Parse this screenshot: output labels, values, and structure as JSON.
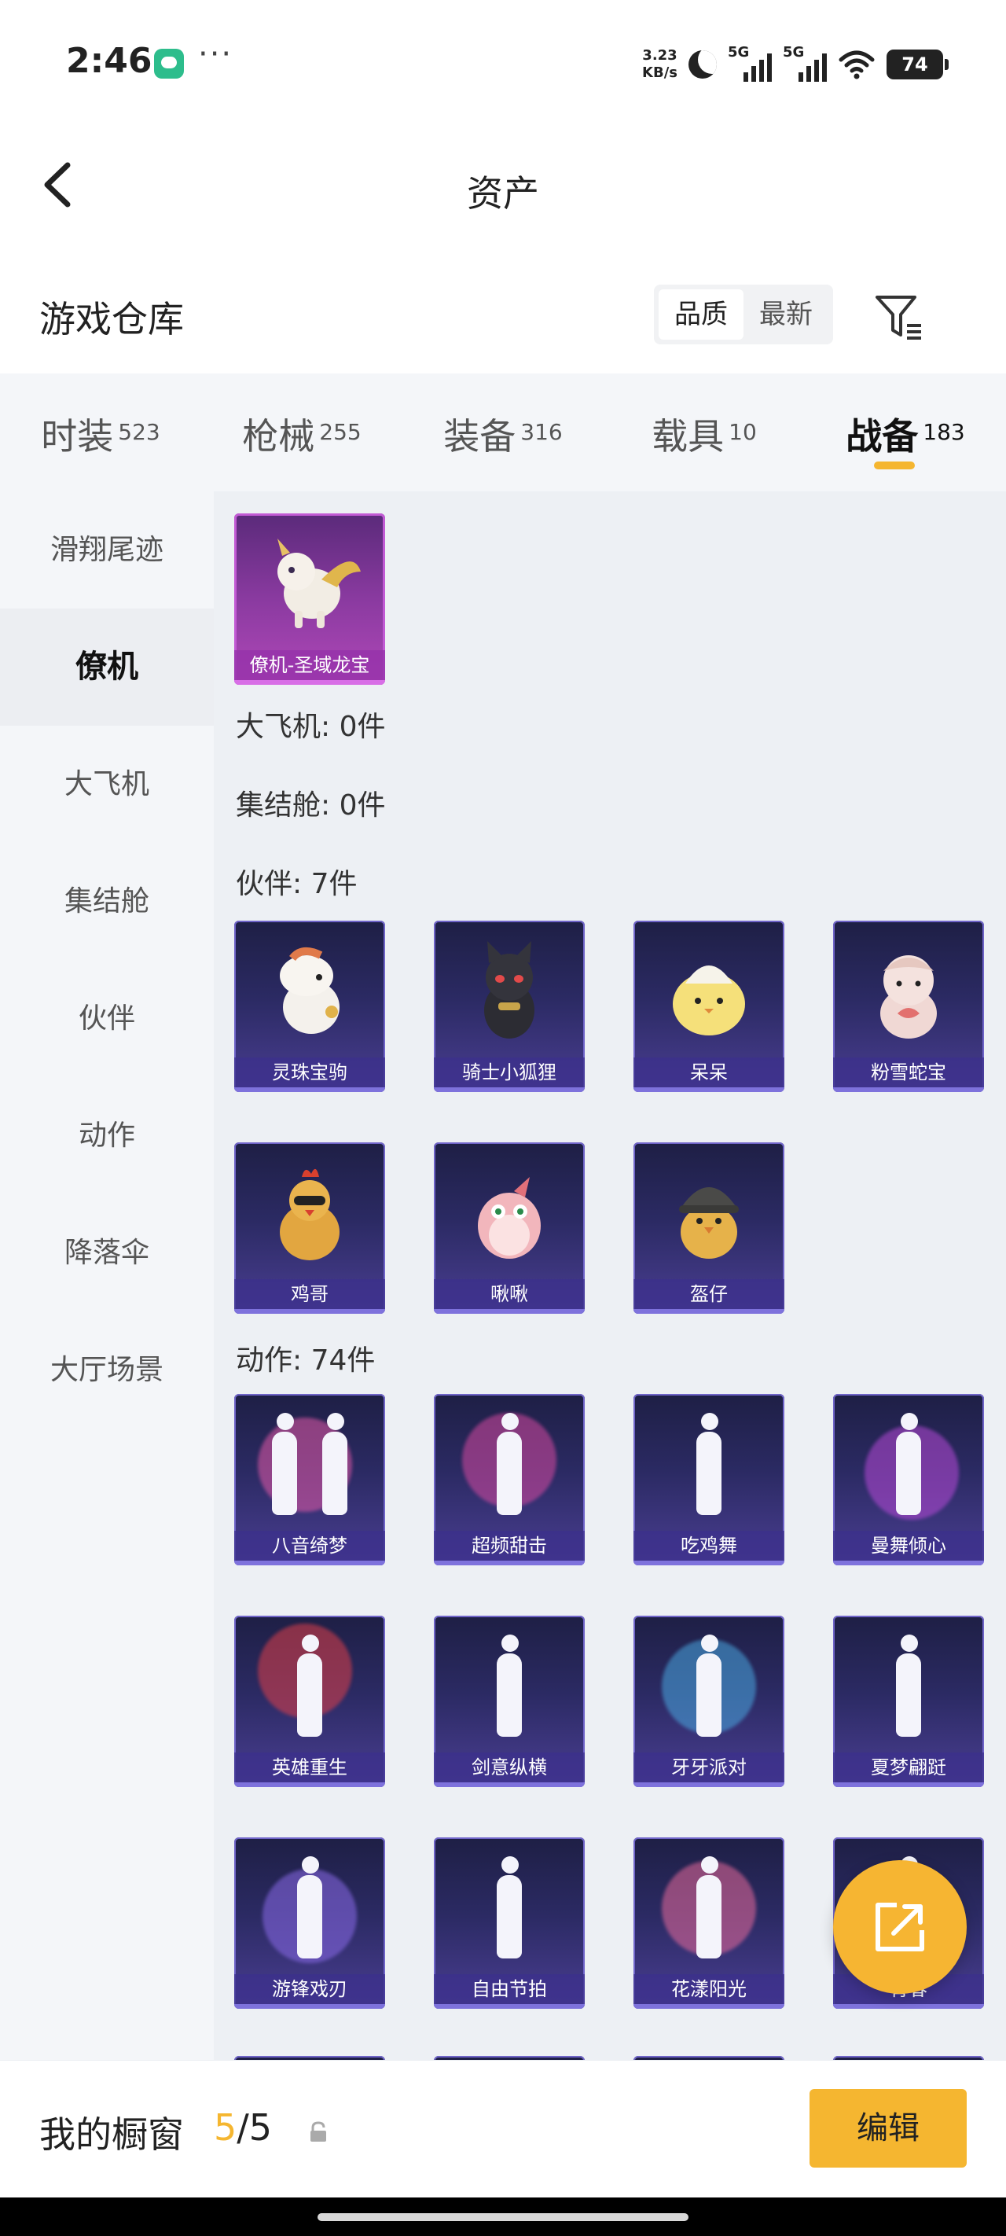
{
  "status": {
    "time": "2:46",
    "more": "···",
    "speed_value": "3.23",
    "speed_unit": "KB/s",
    "sim1": "5G",
    "sim2": "5G",
    "battery": "74"
  },
  "nav": {
    "title": "资产"
  },
  "warehouse": {
    "title": "游戏仓库",
    "sort_quality": "品质",
    "sort_newest": "最新"
  },
  "tabs": [
    {
      "label": "时装",
      "count": "523"
    },
    {
      "label": "枪械",
      "count": "255"
    },
    {
      "label": "装备",
      "count": "316"
    },
    {
      "label": "载具",
      "count": "10"
    },
    {
      "label": "战备",
      "count": "183"
    }
  ],
  "sidebar": [
    {
      "label": "滑翔尾迹"
    },
    {
      "label": "僚机"
    },
    {
      "label": "大飞机"
    },
    {
      "label": "集结舱"
    },
    {
      "label": "伙伴"
    },
    {
      "label": "动作"
    },
    {
      "label": "降落伞"
    },
    {
      "label": "大厅场景"
    }
  ],
  "sections": {
    "plane": "大飞机: 0件",
    "pod": "集结舱: 0件",
    "partner": "伙伴: 7件",
    "emote": "动作: 74件"
  },
  "wingman_items": [
    {
      "name": "僚机-圣域龙宝",
      "icon": "dragon-pet"
    }
  ],
  "partner_items": [
    {
      "name": "灵珠宝驹",
      "icon": "white-horse-pet"
    },
    {
      "name": "骑士小狐狸",
      "icon": "black-fox-pet"
    },
    {
      "name": "呆呆",
      "icon": "yellow-chick-pet"
    },
    {
      "name": "粉雪蛇宝",
      "icon": "pink-snake-pet"
    },
    {
      "name": "鸡哥",
      "icon": "rooster-pet"
    },
    {
      "name": "啾啾",
      "icon": "pink-bird-pet"
    },
    {
      "name": "盔仔",
      "icon": "helmet-chick-pet"
    }
  ],
  "emote_items": [
    {
      "name": "八音绮梦"
    },
    {
      "name": "超频甜击"
    },
    {
      "name": "吃鸡舞"
    },
    {
      "name": "曼舞倾心"
    },
    {
      "name": "英雄重生"
    },
    {
      "name": "剑意纵横"
    },
    {
      "name": "牙牙派对"
    },
    {
      "name": "夏梦翩跹"
    },
    {
      "name": "游锋戏刃"
    },
    {
      "name": "自由节拍"
    },
    {
      "name": "花漾阳光"
    },
    {
      "name": "青春"
    }
  ],
  "bottom": {
    "label": "我的橱窗",
    "current": "5",
    "total": "/5",
    "edit": "编辑"
  },
  "colors": {
    "accent": "#f5b630",
    "card_bg": "#2b2a63",
    "card_border": "#6f64c8",
    "wingman_card_bg": "#8a3aa0"
  }
}
